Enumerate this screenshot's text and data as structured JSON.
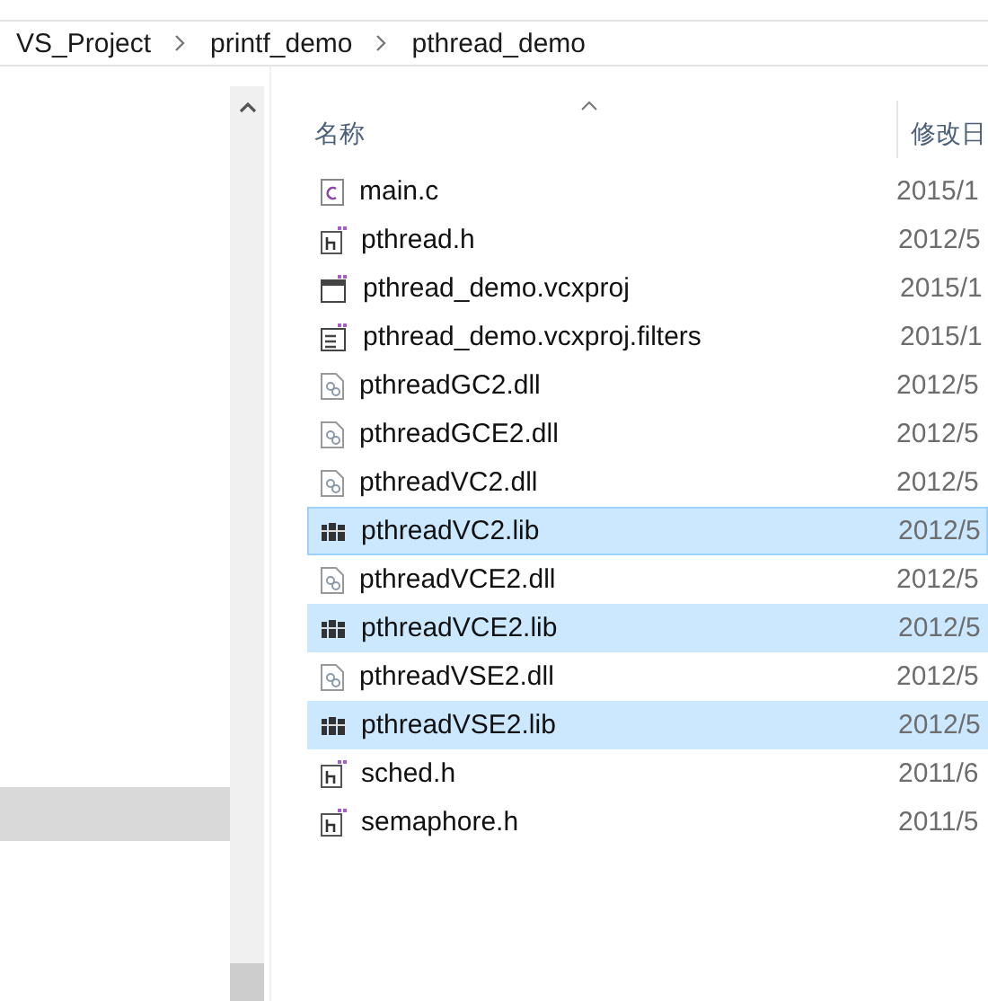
{
  "breadcrumb": [
    "VS_Project",
    "printf_demo",
    "pthread_demo"
  ],
  "nav_pane": {
    "items": [
      {
        "selected": true
      }
    ]
  },
  "columns": [
    {
      "label": "名称",
      "sorted": true
    },
    {
      "label": "修改日"
    }
  ],
  "files": [
    {
      "name": "main.c",
      "date": "2015/1",
      "kind": "c",
      "selected": false
    },
    {
      "name": "pthread.h",
      "date": "2012/5",
      "kind": "h",
      "selected": false
    },
    {
      "name": "pthread_demo.vcxproj",
      "date": "2015/1",
      "kind": "proj",
      "selected": false
    },
    {
      "name": "pthread_demo.vcxproj.filters",
      "date": "2015/1",
      "kind": "filters",
      "selected": false
    },
    {
      "name": "pthreadGC2.dll",
      "date": "2012/5",
      "kind": "dll",
      "selected": false
    },
    {
      "name": "pthreadGCE2.dll",
      "date": "2012/5",
      "kind": "dll",
      "selected": false
    },
    {
      "name": "pthreadVC2.dll",
      "date": "2012/5",
      "kind": "dll",
      "selected": false
    },
    {
      "name": "pthreadVC2.lib",
      "date": "2012/5",
      "kind": "lib",
      "selected": true,
      "focused": true
    },
    {
      "name": "pthreadVCE2.dll",
      "date": "2012/5",
      "kind": "dll",
      "selected": false
    },
    {
      "name": "pthreadVCE2.lib",
      "date": "2012/5",
      "kind": "lib",
      "selected": true
    },
    {
      "name": "pthreadVSE2.dll",
      "date": "2012/5",
      "kind": "dll",
      "selected": false
    },
    {
      "name": "pthreadVSE2.lib",
      "date": "2012/5",
      "kind": "lib",
      "selected": true
    },
    {
      "name": "sched.h",
      "date": "2011/6",
      "kind": "h",
      "selected": false
    },
    {
      "name": "semaphore.h",
      "date": "2011/5",
      "kind": "h",
      "selected": false
    }
  ]
}
